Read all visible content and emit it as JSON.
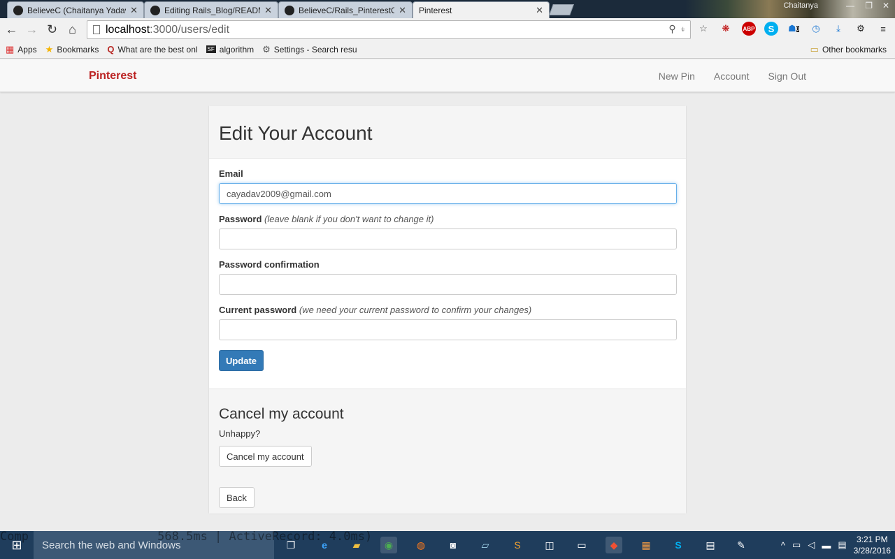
{
  "browser": {
    "tabs": [
      {
        "title": "BelieveC (Chaitanya Yadav",
        "icon": "github-icon"
      },
      {
        "title": "Editing Rails_Blog/READM",
        "icon": "github-icon"
      },
      {
        "title": "BelieveC/Rails_PinterestCl",
        "icon": "github-icon"
      },
      {
        "title": "Pinterest",
        "icon": "page-icon"
      }
    ],
    "window_user": "Chaitanya",
    "address_host": "localhost",
    "address_path": ":3000/users/edit",
    "bookmarks": [
      {
        "label": "Apps",
        "icon": "apps-icon"
      },
      {
        "label": "Bookmarks",
        "icon": "star-icon"
      },
      {
        "label": "What are the best onl",
        "icon": "quora-icon"
      },
      {
        "label": "algorithm",
        "icon": "sf-icon"
      },
      {
        "label": "Settings - Search resu",
        "icon": "gear-icon"
      }
    ],
    "other_bookmarks": "Other bookmarks",
    "extensions": {
      "abp": "ABP",
      "badge": "0"
    }
  },
  "app": {
    "brand": "Pinterest",
    "nav": {
      "new_pin": "New Pin",
      "account": "Account",
      "sign_out": "Sign Out"
    },
    "title": "Edit Your Account",
    "email_label": "Email",
    "email_value": "cayadav2009@gmail.com",
    "password_label": "Password",
    "password_hint": "(leave blank if you don't want to change it)",
    "password_confirmation_label": "Password confirmation",
    "current_password_label": "Current password",
    "current_password_hint": "(we need your current password to confirm your changes)",
    "update_button": "Update",
    "cancel_heading": "Cancel my account",
    "cancel_text": "Unhappy?",
    "cancel_button": "Cancel my account",
    "back_button": "Back"
  },
  "taskbar": {
    "search_placeholder": "Search the web and Windows",
    "console_text": "Comp                  568.5ms | ActiveRecord: 4.0ms)",
    "time": "3:21 PM",
    "date": "3/28/2016"
  }
}
